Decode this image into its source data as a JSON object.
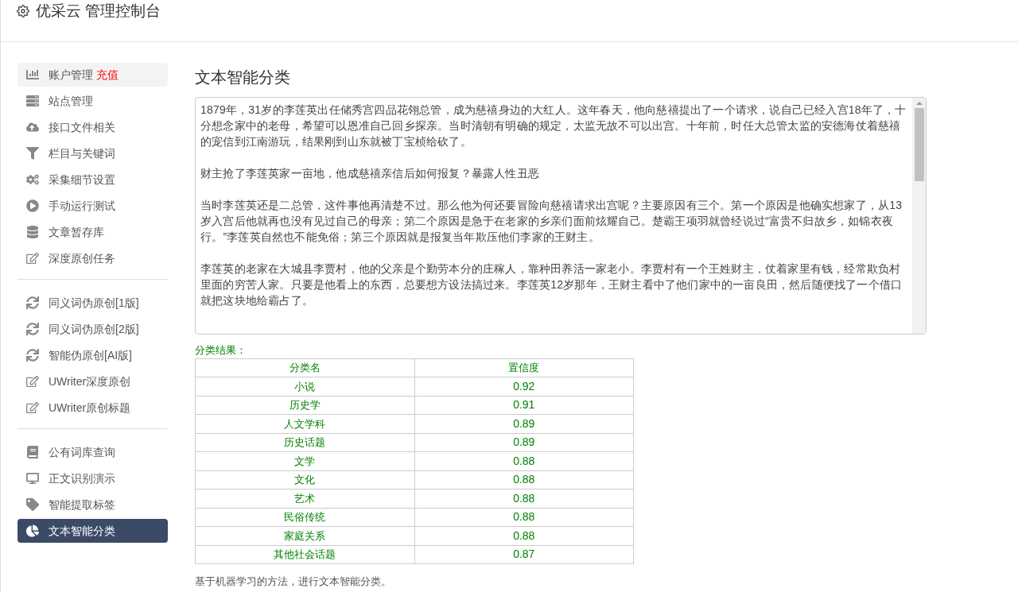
{
  "header": {
    "title": "优采云 管理控制台"
  },
  "sidebar": {
    "groups": [
      {
        "items": [
          {
            "label": "账户管理",
            "badge": "充值",
            "hovered": true,
            "selected": false
          },
          {
            "label": "站点管理",
            "selected": false
          },
          {
            "label": "接口文件相关",
            "selected": false
          },
          {
            "label": "栏目与关键词",
            "selected": false
          },
          {
            "label": "采集细节设置",
            "selected": false
          },
          {
            "label": "手动运行测试",
            "selected": false
          },
          {
            "label": "文章暂存库",
            "selected": false
          },
          {
            "label": "深度原创任务",
            "selected": false
          }
        ]
      },
      {
        "items": [
          {
            "label": "同义词伪原创[1版]",
            "selected": false
          },
          {
            "label": "同义词伪原创[2版]",
            "selected": false
          },
          {
            "label": "智能伪原创[AI版]",
            "selected": false
          },
          {
            "label": "UWriter深度原创",
            "selected": false
          },
          {
            "label": "UWriter原创标题",
            "selected": false
          }
        ]
      },
      {
        "items": [
          {
            "label": "公有词库查询",
            "selected": false
          },
          {
            "label": "正文识别演示",
            "selected": false
          },
          {
            "label": "智能提取标签",
            "selected": false
          },
          {
            "label": "文本智能分类",
            "selected": true
          }
        ]
      }
    ]
  },
  "main": {
    "title": "文本智能分类",
    "input_text": [
      "1879年，31岁的李莲英出任储秀宫四品花翎总管，成为慈禧身边的大红人。这年春天，他向慈禧提出了一个请求，说自己已经入宫18年了，十分想念家中的老母，希望可以恩准自己回乡探亲。当时清朝有明确的规定，太监无故不可以出宫。十年前，时任大总管太监的安德海仗着慈禧的宠信到江南游玩，结果刚到山东就被丁宝桢给砍了。",
      "财主抢了李莲英家一亩地，他成慈禧亲信后如何报复？暴露人性丑恶",
      "当时李莲英还是二总管，这件事他再清楚不过。那么他为何还要冒险向慈禧请求出宫呢？主要原因有三个。第一个原因是他确实想家了，从13岁入宫后他就再也没有见过自己的母亲；第二个原因是急于在老家的乡亲们面前炫耀自己。楚霸王项羽就曾经说过“富贵不归故乡，如锦衣夜行。”李莲英自然也不能免俗；第三个原因就是报复当年欺压他们李家的王财主。",
      "李莲英的老家在大城县李贾村，他的父亲是个勤劳本分的庄稼人，靠种田养活一家老小。李贾村有一个王姓财主，仗着家里有钱，经常欺负村里面的穷苦人家。只要是他看上的东西，总要想方设法搞过来。李莲英12岁那年，王财主看中了他们家中的一亩良田，然后随便找了一个借口就把这块地给霸占了。"
    ],
    "result_label": "分类结果：",
    "table": {
      "columns": [
        "分类名",
        "置信度"
      ],
      "rows": [
        [
          "小说",
          "0.92"
        ],
        [
          "历史学",
          "0.91"
        ],
        [
          "人文学科",
          "0.89"
        ],
        [
          "历史话题",
          "0.89"
        ],
        [
          "文学",
          "0.88"
        ],
        [
          "文化",
          "0.88"
        ],
        [
          "艺术",
          "0.88"
        ],
        [
          "民俗传统",
          "0.88"
        ],
        [
          "家庭关系",
          "0.88"
        ],
        [
          "其他社会话题",
          "0.87"
        ]
      ]
    },
    "footnote": "基于机器学习的方法，进行文本智能分类。"
  }
}
